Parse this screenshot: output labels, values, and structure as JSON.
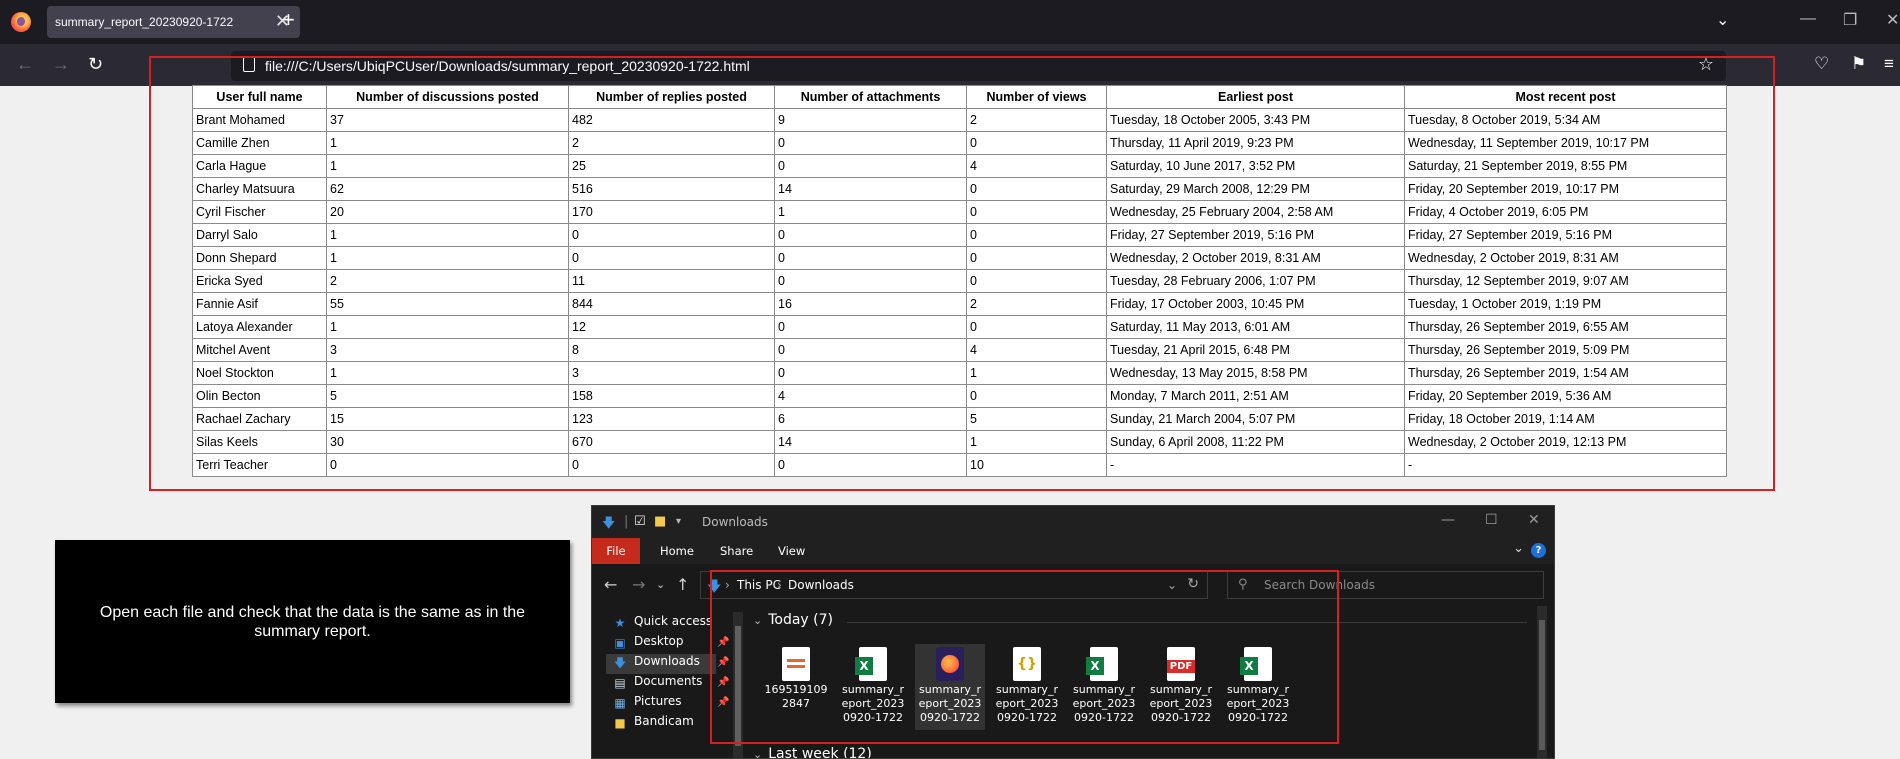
{
  "browser": {
    "tab_title": "summary_report_20230920-1722",
    "tab_close": "✕",
    "new_tab": "+",
    "url": "file:///C:/Users/UbiqPCUser/Downloads/summary_report_20230920-1722.html"
  },
  "report": {
    "columns": [
      "User full name",
      "Number of discussions posted",
      "Number of replies posted",
      "Number of attachments",
      "Number of views",
      "Earliest post",
      "Most recent post"
    ],
    "rows": [
      [
        "Brant Mohamed",
        "37",
        "482",
        "9",
        "2",
        "Tuesday, 18 October 2005, 3:43 PM",
        "Tuesday, 8 October 2019, 5:34 AM"
      ],
      [
        "Camille Zhen",
        "1",
        "2",
        "0",
        "0",
        "Thursday, 11 April 2019, 9:23 PM",
        "Wednesday, 11 September 2019, 10:17 PM"
      ],
      [
        "Carla Hague",
        "1",
        "25",
        "0",
        "4",
        "Saturday, 10 June 2017, 3:52 PM",
        "Saturday, 21 September 2019, 8:55 PM"
      ],
      [
        "Charley Matsuura",
        "62",
        "516",
        "14",
        "0",
        "Saturday, 29 March 2008, 12:29 PM",
        "Friday, 20 September 2019, 10:17 PM"
      ],
      [
        "Cyril Fischer",
        "20",
        "170",
        "1",
        "0",
        "Wednesday, 25 February 2004, 2:58 AM",
        "Friday, 4 October 2019, 6:05 PM"
      ],
      [
        "Darryl Salo",
        "1",
        "0",
        "0",
        "0",
        "Friday, 27 September 2019, 5:16 PM",
        "Friday, 27 September 2019, 5:16 PM"
      ],
      [
        "Donn Shepard",
        "1",
        "0",
        "0",
        "0",
        "Wednesday, 2 October 2019, 8:31 AM",
        "Wednesday, 2 October 2019, 8:31 AM"
      ],
      [
        "Ericka Syed",
        "2",
        "11",
        "0",
        "0",
        "Tuesday, 28 February 2006, 1:07 PM",
        "Thursday, 12 September 2019, 9:07 AM"
      ],
      [
        "Fannie Asif",
        "55",
        "844",
        "16",
        "2",
        "Friday, 17 October 2003, 10:45 PM",
        "Tuesday, 1 October 2019, 1:19 PM"
      ],
      [
        "Latoya Alexander",
        "1",
        "12",
        "0",
        "0",
        "Saturday, 11 May 2013, 6:01 AM",
        "Thursday, 26 September 2019, 6:55 AM"
      ],
      [
        "Mitchel Avent",
        "3",
        "8",
        "0",
        "4",
        "Tuesday, 21 April 2015, 6:48 PM",
        "Thursday, 26 September 2019, 5:09 PM"
      ],
      [
        "Noel Stockton",
        "1",
        "3",
        "0",
        "1",
        "Wednesday, 13 May 2015, 8:58 PM",
        "Thursday, 26 September 2019, 1:54 AM"
      ],
      [
        "Olin Becton",
        "5",
        "158",
        "4",
        "0",
        "Monday, 7 March 2011, 2:51 AM",
        "Friday, 20 September 2019, 5:36 AM"
      ],
      [
        "Rachael Zachary",
        "15",
        "123",
        "6",
        "5",
        "Sunday, 21 March 2004, 5:07 PM",
        "Friday, 18 October 2019, 1:14 AM"
      ],
      [
        "Silas Keels",
        "30",
        "670",
        "14",
        "1",
        "Sunday, 6 April 2008, 11:22 PM",
        "Wednesday, 2 October 2019, 12:13 PM"
      ],
      [
        "Terri Teacher",
        "0",
        "0",
        "0",
        "10",
        "-",
        "-"
      ]
    ]
  },
  "instruction": "Open each file and check that the data is the same as in the summary report.",
  "explorer": {
    "title": "Downloads",
    "ribbon_tabs": [
      "File",
      "Home",
      "Share",
      "View"
    ],
    "help": "?",
    "breadcrumbs": [
      "This PC",
      "Downloads"
    ],
    "search_placeholder": "Search Downloads",
    "nav_items": [
      "Quick access",
      "Desktop",
      "Downloads",
      "Documents",
      "Pictures",
      "Bandicam"
    ],
    "group_today": "Today (7)",
    "group_last_week": "Last week (12)",
    "files": [
      {
        "name": "1695191092847",
        "type": "generic"
      },
      {
        "name": "summary_report_20230920-1722",
        "type": "excel"
      },
      {
        "name": "summary_report_20230920-1722",
        "type": "firefox"
      },
      {
        "name": "summary_report_20230920-1722",
        "type": "json"
      },
      {
        "name": "summary_report_20230920-1722",
        "type": "excel"
      },
      {
        "name": "summary_report_20230920-1722",
        "type": "pdf"
      },
      {
        "name": "summary_report_20230920-1722",
        "type": "excel"
      }
    ]
  },
  "colors": {
    "highlight": "#d32020",
    "accent_file_tab": "#c42b1c",
    "browser_bg": "#1c1b22"
  }
}
